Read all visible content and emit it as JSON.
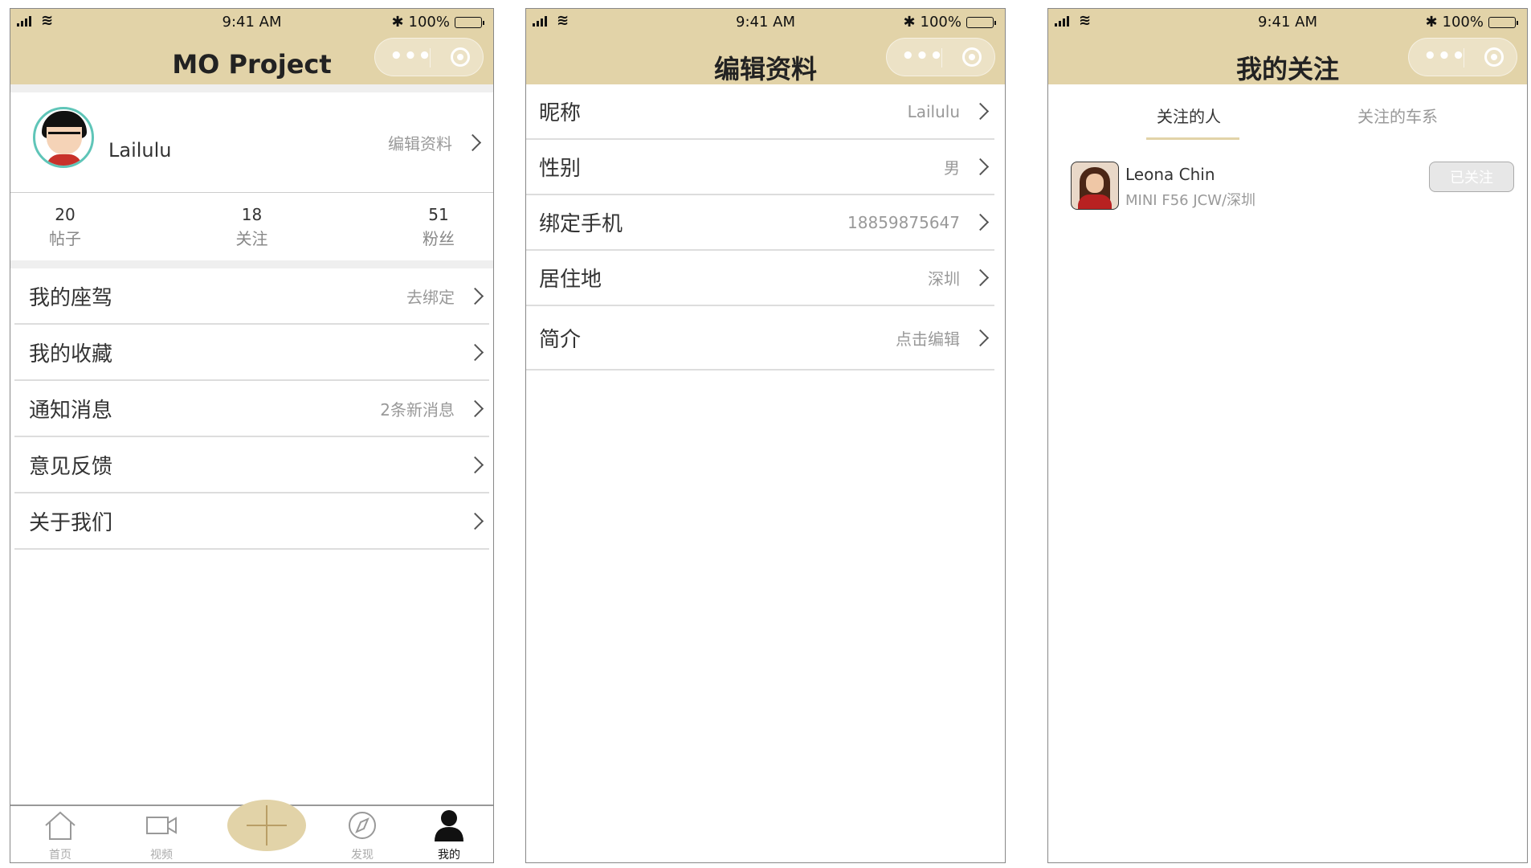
{
  "statusbar": {
    "time": "9:41 AM",
    "battery": "100%",
    "bluetooth_icon": "bluetooth-icon",
    "battery_icon": "battery-icon"
  },
  "screens": [
    {
      "title": "MO Project",
      "profile": {
        "name": "Lailulu",
        "edit_label": "编辑资料"
      },
      "stats": [
        {
          "value": "20",
          "label": "帖子"
        },
        {
          "value": "18",
          "label": "关注"
        },
        {
          "value": "51",
          "label": "粉丝"
        }
      ],
      "menu": [
        {
          "label": "我的座驾",
          "value": "去绑定"
        },
        {
          "label": "我的收藏",
          "value": ""
        },
        {
          "label": "通知消息",
          "value": "2条新消息"
        },
        {
          "label": "意见反馈",
          "value": ""
        },
        {
          "label": "关于我们",
          "value": ""
        }
      ],
      "tabbar": [
        {
          "label": "首页",
          "icon": "home-icon"
        },
        {
          "label": "视频",
          "icon": "video-icon"
        },
        {
          "label": "",
          "icon": "plus-icon"
        },
        {
          "label": "发现",
          "icon": "compass-icon"
        },
        {
          "label": "我的",
          "icon": "user-icon",
          "active": true
        }
      ]
    },
    {
      "title": "编辑资料",
      "rows": [
        {
          "label": "昵称",
          "value": "Lailulu"
        },
        {
          "label": "性别",
          "value": "男"
        },
        {
          "label": "绑定手机",
          "value": "18859875647"
        },
        {
          "label": "居住地",
          "value": "深圳"
        },
        {
          "label": "简介",
          "value": "点击编辑"
        }
      ]
    },
    {
      "title": "我的关注",
      "tabs": [
        {
          "label": "关注的人",
          "active": true
        },
        {
          "label": "关注的车系",
          "active": false
        }
      ],
      "follows": [
        {
          "name": "Leona Chin",
          "subtitle": "MINI  F56 JCW/深圳",
          "button": "已关注"
        }
      ]
    }
  ],
  "colors": {
    "header": "#e2d3a8",
    "accent_underline": "#e2d3a8",
    "avatar_ring": "#5fc5b8",
    "divider": "#dddddd"
  }
}
